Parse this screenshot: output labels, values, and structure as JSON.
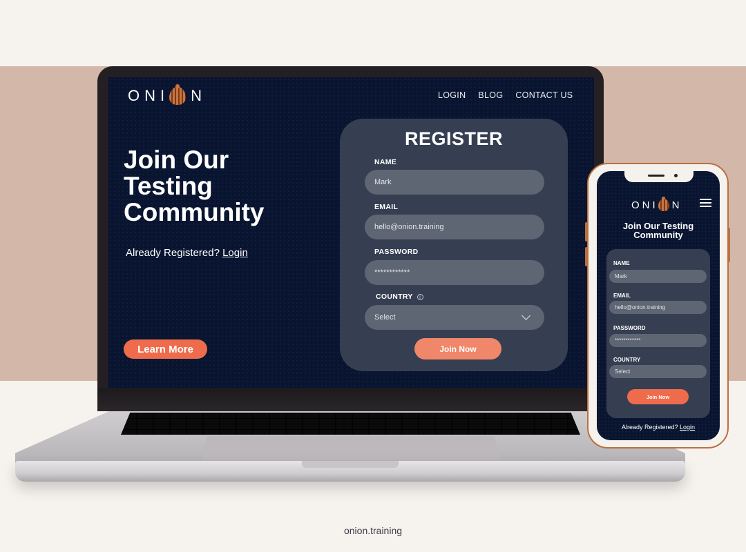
{
  "brand": {
    "logo_left": "ONI",
    "logo_right": "N",
    "accent": "#ee6c4c",
    "navy": "#091530",
    "card": "#363f52"
  },
  "desktop": {
    "nav": [
      "LOGIN",
      "BLOG",
      "CONTACT US"
    ],
    "hero": {
      "title_lines": [
        "Join Our",
        "Testing",
        "Community"
      ],
      "already_text": "Already Registered?",
      "login_link": "Login",
      "learn_more": "Learn More"
    },
    "form": {
      "title": "REGISTER",
      "name_label": "NAME",
      "name_value": "Mark",
      "email_label": "EMAIL",
      "email_value": "hello@onion.training",
      "password_label": "PASSWORD",
      "password_value": "************",
      "country_label": "COUNTRY",
      "country_info_icon": "ⓘ",
      "country_value": "Select",
      "submit": "Join Now"
    }
  },
  "mobile": {
    "title_lines": [
      "Join Our Testing",
      "Community"
    ],
    "form": {
      "name_label": "NAME",
      "name_value": "Mark",
      "email_label": "EMAIL",
      "email_value": "hello@onion.training",
      "password_label": "PASSWORD",
      "password_value": "************",
      "country_label": "COUNTRY",
      "country_value": "Select",
      "submit": "Join Now"
    },
    "already_text": "Already Registered?",
    "login_link": "Login"
  },
  "footer": {
    "url": "onion.training"
  }
}
